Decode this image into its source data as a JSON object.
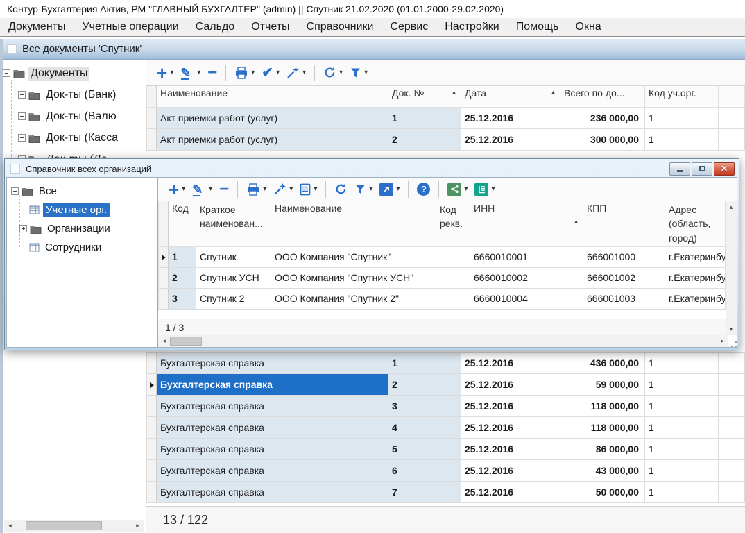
{
  "app": {
    "title": "Контур-Бухгалтерия Актив, РМ \"ГЛАВНЫЙ БУХГАЛТЕР\" (admin) || Спутник 21.02.2020 (01.01.2000-29.02.2020)"
  },
  "menu": {
    "items": [
      "Документы",
      "Учетные операции",
      "Сальдо",
      "Отчеты",
      "Справочники",
      "Сервис",
      "Настройки",
      "Помощь",
      "Окна"
    ]
  },
  "colors": {
    "accent_blue": "#2a6fc9",
    "selection_blue": "#1e6fc8",
    "icon_green": "#4f9263",
    "icon_teal": "#12a48e",
    "close_red": "#c23a22"
  },
  "main_window": {
    "title": "Все документы  'Спутник'",
    "tree": {
      "root": "Документы",
      "items": [
        "Док-ты (Банк)",
        "Док-ты (Валю",
        "Док-ты (Касса",
        "Док-ты (Дв"
      ]
    },
    "toolbar_icons": [
      "add",
      "edit",
      "delete",
      "print",
      "confirm",
      "magic-wand",
      "refresh",
      "filter"
    ],
    "table": {
      "columns": [
        "Наименование",
        "Док. №",
        "Дата",
        "Всего по до...",
        "Код уч.орг."
      ],
      "rows_top": [
        {
          "name": "Акт приемки работ (услуг)",
          "num": "1",
          "date": "25.12.2016",
          "total": "236 000,00",
          "org": "1"
        },
        {
          "name": "Акт приемки работ (услуг)",
          "num": "2",
          "date": "25.12.2016",
          "total": "300 000,00",
          "org": "1"
        }
      ],
      "rows_bottom": [
        {
          "name": "Бухгалтерская справка",
          "num": "1",
          "date": "25.12.2016",
          "total": "436 000,00",
          "org": "1"
        },
        {
          "name": "Бухгалтерская справка",
          "num": "2",
          "date": "25.12.2016",
          "total": "59 000,00",
          "org": "1"
        },
        {
          "name": "Бухгалтерская справка",
          "num": "3",
          "date": "25.12.2016",
          "total": "118 000,00",
          "org": "1"
        },
        {
          "name": "Бухгалтерская справка",
          "num": "4",
          "date": "25.12.2016",
          "total": "118 000,00",
          "org": "1"
        },
        {
          "name": "Бухгалтерская справка",
          "num": "5",
          "date": "25.12.2016",
          "total": "86 000,00",
          "org": "1"
        },
        {
          "name": "Бухгалтерская справка",
          "num": "6",
          "date": "25.12.2016",
          "total": "43 000,00",
          "org": "1"
        },
        {
          "name": "Бухгалтерская справка",
          "num": "7",
          "date": "25.12.2016",
          "total": "50 000,00",
          "org": "1"
        }
      ],
      "counter": "13 / 122"
    }
  },
  "dialog": {
    "title": "Справочник всех организаций",
    "tree": {
      "root": "Все",
      "items": [
        {
          "label": "Учетные орг.",
          "selected": true
        },
        {
          "label": "Организации",
          "selected": false
        },
        {
          "label": "Сотрудники",
          "selected": false
        }
      ]
    },
    "toolbar_icons": [
      "add",
      "edit",
      "delete",
      "print",
      "magic-wand",
      "report",
      "refresh",
      "filter",
      "expand",
      "help",
      "links",
      "journal"
    ],
    "table": {
      "columns": [
        "Код",
        "Краткое наименован...",
        "Наименование",
        "Код рекв.",
        "ИНН",
        "КПП",
        "Адрес (область, город)"
      ],
      "rows": [
        {
          "code": "1",
          "short": "Спутник",
          "name": "ООО Компания \"Спутник\"",
          "kod_rekv": "",
          "inn": "6660010001",
          "kpp": "666001000",
          "address": "г.Екатеринбург"
        },
        {
          "code": "2",
          "short": "Спутник УСН",
          "name": "ООО Компания \"Спутник УСН\"",
          "kod_rekv": "",
          "inn": "6660010002",
          "kpp": "666001002",
          "address": "г.Екатеринбург"
        },
        {
          "code": "3",
          "short": "Спутник 2",
          "name": "ООО Компания \"Спутник 2\"",
          "kod_rekv": "",
          "inn": "6660010004",
          "kpp": "666001003",
          "address": "г.Екатеринбург"
        }
      ],
      "counter": "1 / 3"
    }
  }
}
